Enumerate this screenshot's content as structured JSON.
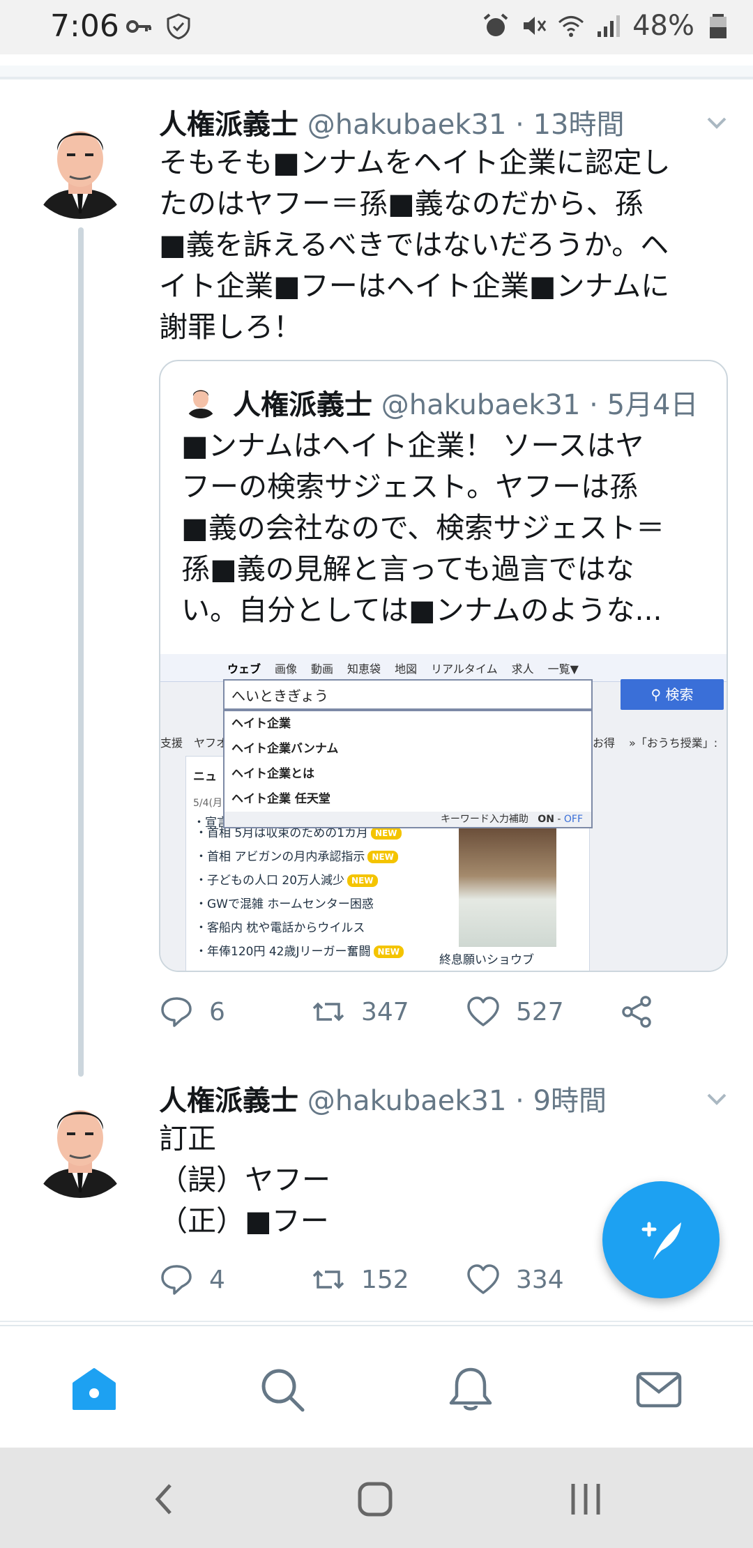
{
  "status_bar": {
    "time": "7:06",
    "battery": "48%"
  },
  "tweets": [
    {
      "name": "人権派義士",
      "handle": "@hakubaek31",
      "time": "13時間",
      "text_lines": [
        "そもそも■ンナムをヘイト企業に認定し",
        "たのはヤフー＝孫■義なのだから、孫",
        "■義を訴えるべきではないだろうか。ヘ",
        "イト企業■フーはヘイト企業■ンナムに",
        "謝罪しろ！"
      ],
      "quote": {
        "name": "人権派義士",
        "handle": "@hakubaek31",
        "time": "5月4日",
        "text_lines": [
          "■ンナムはヘイト企業！ ソースはヤ",
          "フーの検索サジェスト。ヤフーは孫",
          "■義の会社なので、検索サジェスト＝",
          "孫■義の見解と言っても過言ではな",
          "い。自分としては■ンナムのような..."
        ],
        "media": {
          "tabs": [
            "ウェブ",
            "画像",
            "動画",
            "知恵袋",
            "地図",
            "リアルタイム",
            "求人",
            "一覧▼"
          ],
          "search_value": "へいときぎょう",
          "search_button": "検索",
          "suggestions": [
            "ヘイト企業",
            "ヘイト企業バンナム",
            "ヘイト企業とは",
            "ヘイト企業 任天堂"
          ],
          "assist_label": "キーワード入力補助",
          "assist_on": "ON",
          "assist_sep": " - ",
          "assist_off": "OFF",
          "strip_left": "支援　ヤフオ",
          "strip_mid": "お得",
          "strip_right": "»「おうち授業」:",
          "panel_title": "ニュ",
          "news_date": "5/4(月",
          "news_partial": "・宣言",
          "news_items": [
            {
              "text": "・首相 5月は収束のための1カ月",
              "new": "NEW"
            },
            {
              "text": "・首相 アビガンの月内承認指示",
              "new": "NEW"
            },
            {
              "text": "・子どもの人口 20万人減少",
              "new": "NEW"
            },
            {
              "text": "・GWで混雑 ホームセンター困惑",
              "new": ""
            },
            {
              "text": "・客船内 枕や電話からウイルス",
              "new": ""
            },
            {
              "text": "・年俸120円 42歳Jリーガー奮闘",
              "new": "NEW"
            }
          ],
          "photo_caption": "終息願いショウブ"
        }
      },
      "replies": "6",
      "retweets": "347",
      "likes": "527"
    },
    {
      "name": "人権派義士",
      "handle": "@hakubaek31",
      "time": "9時間",
      "text_lines": [
        "訂正",
        "（誤）ヤフー",
        "（正）■フー"
      ],
      "replies": "4",
      "retweets": "152",
      "likes": "334"
    }
  ],
  "separator": "·",
  "colors": {
    "accent": "#1da1f2",
    "secondary_text": "#657786",
    "border": "#ccd6dd"
  },
  "icons": {
    "home": "home-icon",
    "search": "search-icon",
    "notifications": "bell-icon",
    "messages": "mail-icon",
    "compose": "compose-icon"
  }
}
